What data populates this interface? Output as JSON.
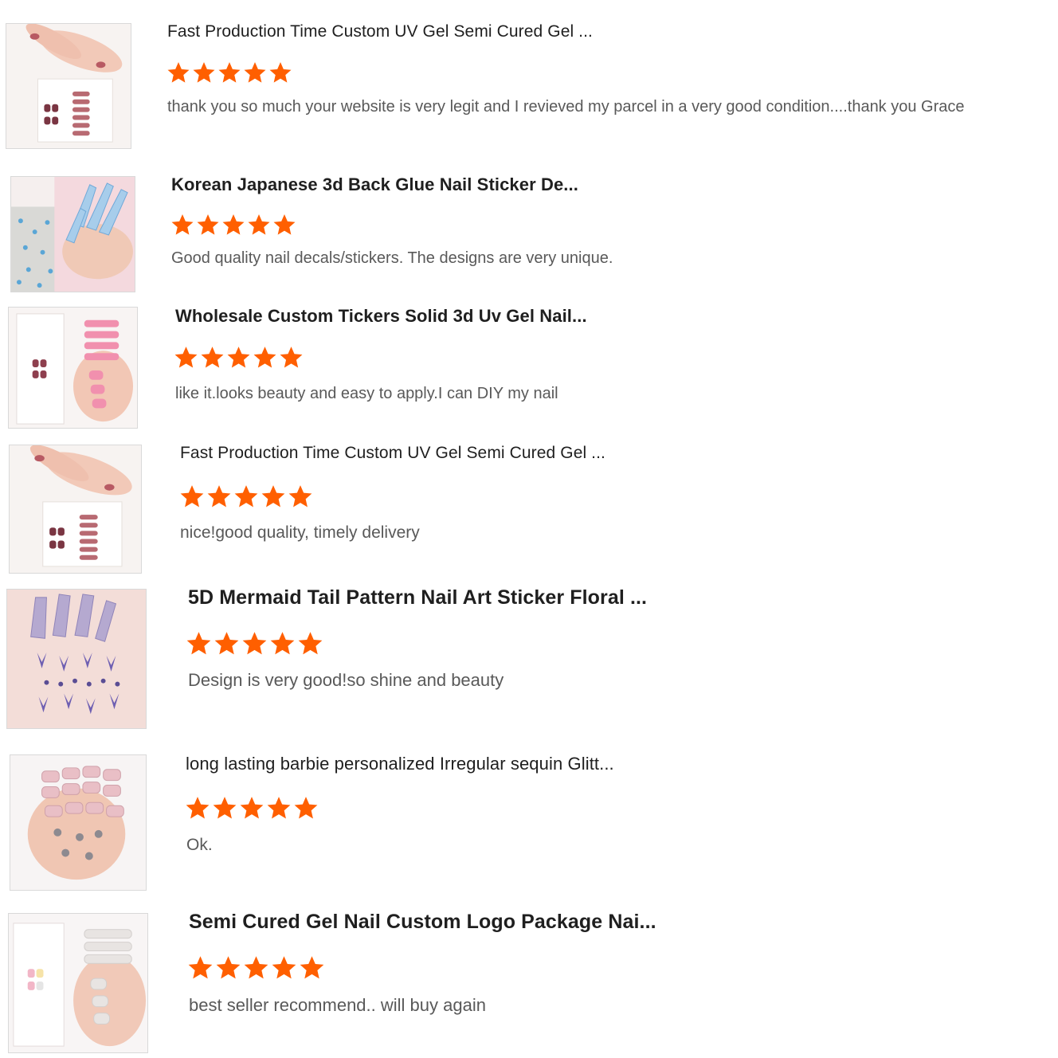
{
  "accent_color": "#ff5f00",
  "reviews": [
    {
      "product_title": "Fast Production Time Custom UV Gel Semi Cured Gel ...",
      "rating": 5,
      "comment": "thank you so much your website is very legit and  I revieved my parcel in a very good condition....thank you Grace",
      "image": "nail-wrap-product-image"
    },
    {
      "product_title": "Korean Japanese 3d Back Glue Nail Sticker De...",
      "rating": 5,
      "comment": "Good quality nail decals/stickers. The designs are very unique.",
      "image": "nail-sticker-product-image"
    },
    {
      "product_title": "Wholesale Custom Tickers Solid 3d Uv Gel Nail...",
      "rating": 5,
      "comment": "like it.looks beauty and easy to apply.I can DIY my nail",
      "image": "nail-wrap-product-image"
    },
    {
      "product_title": "Fast Production Time Custom UV Gel Semi Cured Gel ...",
      "rating": 5,
      "comment": "nice!good quality, timely delivery",
      "image": "nail-wrap-product-image"
    },
    {
      "product_title": "5D Mermaid Tail Pattern Nail Art Sticker Floral ...",
      "rating": 5,
      "comment": "Design is very good!so shine and beauty",
      "image": "nail-art-sticker-product-image"
    },
    {
      "product_title": "long lasting barbie personalized Irregular sequin Glitt...",
      "rating": 5,
      "comment": "Ok.",
      "image": "glitter-nail-wrap-product-image"
    },
    {
      "product_title": "Semi Cured Gel Nail Custom Logo Package Nai...",
      "rating": 5,
      "comment": "best seller recommend.. will buy again",
      "image": "gel-nail-package-product-image"
    }
  ]
}
